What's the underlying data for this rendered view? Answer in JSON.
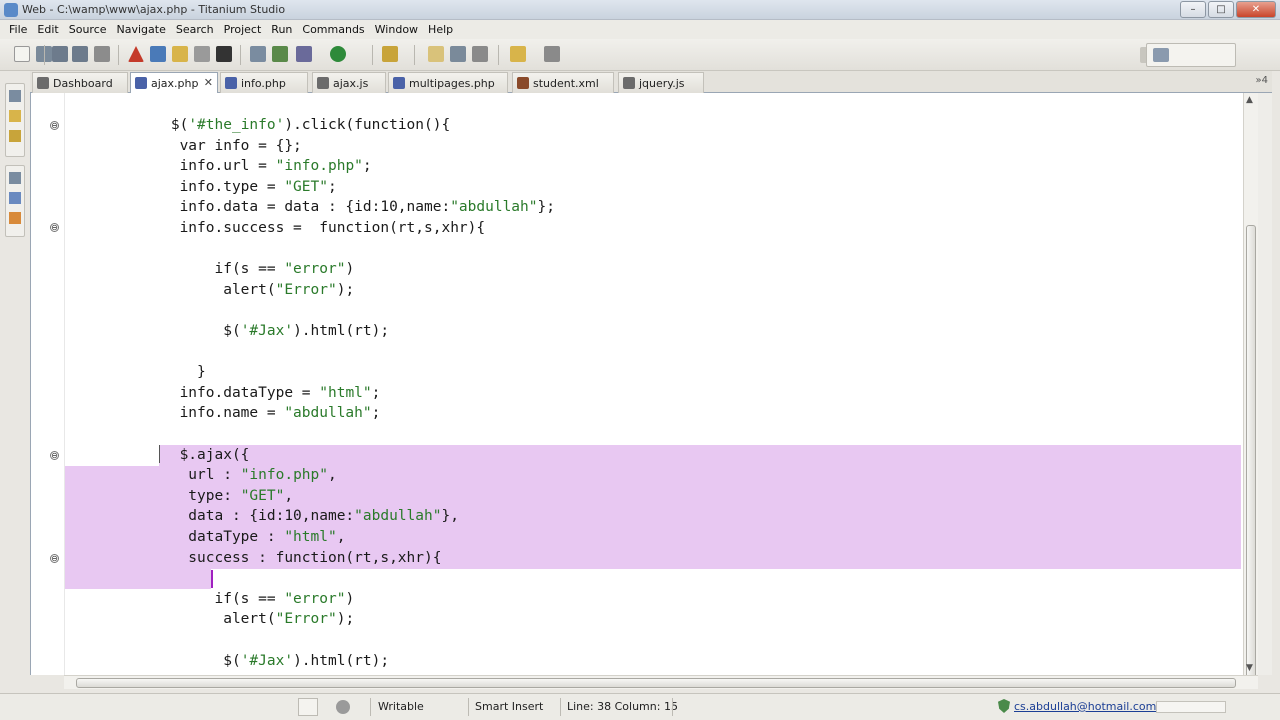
{
  "window": {
    "title": "Web - C:\\wamp\\www\\ajax.php - Titanium Studio",
    "minimize": "–",
    "maximize": "□",
    "close": "✕"
  },
  "menu": [
    "File",
    "Edit",
    "Source",
    "Navigate",
    "Search",
    "Project",
    "Run",
    "Commands",
    "Window",
    "Help"
  ],
  "tabs": [
    {
      "label": "Dashboard",
      "color": "#6b6b6b"
    },
    {
      "label": "ajax.php",
      "color": "#4a62a8",
      "active": true
    },
    {
      "label": "info.php",
      "color": "#4a62a8"
    },
    {
      "label": "ajax.js",
      "color": "#6b6b6b"
    },
    {
      "label": "multipages.php",
      "color": "#4a62a8"
    },
    {
      "label": "student.xml",
      "color": "#8a4a2a"
    },
    {
      "label": "jquery.js",
      "color": "#6b6b6b"
    }
  ],
  "tab_overflow": "»4",
  "tab_close": "✕",
  "code_lines": [
    "        $('#the_info').click(function(){",
    "         var info = {};",
    "         info.url = \"info.php\";",
    "         info.type = \"GET\";",
    "         info.data = data : {id:10,name:\"abdullah\"};",
    "         info.success =  function(rt,s,xhr){",
    "",
    "             if(s == \"error\")",
    "              alert(\"Error\");",
    "",
    "              $('#Jax').html(rt);",
    "",
    "           }",
    "         info.dataType = \"html\";",
    "         info.name = \"abdullah\";",
    "",
    "         $.ajax({",
    "          url : \"info.php\",",
    "          type: \"GET\",",
    "          data : {id:10,name:\"abdullah\"},",
    "          dataType : \"html\",",
    "          success : function(rt,s,xhr){",
    "",
    "             if(s == \"error\")",
    "              alert(\"Error\");",
    "",
    "              $('#Jax').html(rt);"
  ],
  "fold_markers": "⊖",
  "status": {
    "writable": "Writable",
    "insert_mode": "Smart Insert",
    "position": "Line: 38 Column: 15",
    "user": "cs.abdullah@hotmail.com"
  },
  "icons": {
    "perspective": "web-perspective-icon",
    "scroll_up": "▲",
    "scroll_down": "▼",
    "scroll_left": "◀",
    "scroll_right": "▶"
  }
}
